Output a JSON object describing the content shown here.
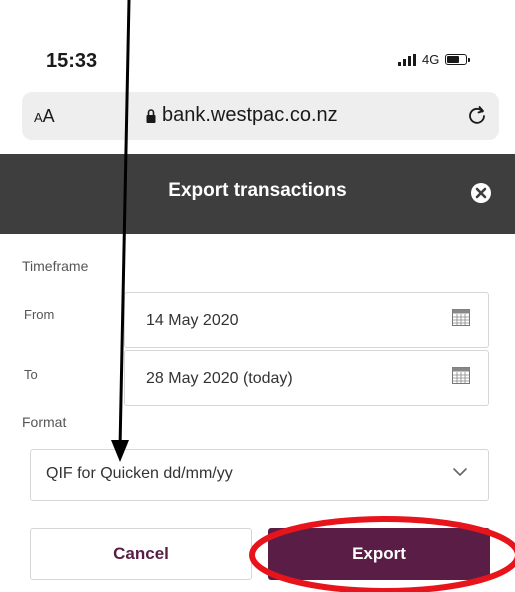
{
  "status_bar": {
    "time": "15:33",
    "network": "4G",
    "battery_level": 0.7
  },
  "browser": {
    "text_size_label_small": "A",
    "text_size_label_large": "A",
    "url": "bank.westpac.co.nz"
  },
  "dialog": {
    "title": "Export transactions",
    "timeframe_label": "Timeframe",
    "from_label": "From",
    "from_value": "14 May 2020",
    "to_label": "To",
    "to_value": "28 May 2020 (today)",
    "format_label": "Format",
    "format_value": "QIF for Quicken dd/mm/yy",
    "cancel_label": "Cancel",
    "export_label": "Export"
  },
  "colors": {
    "header_bg": "#3e3e3e",
    "accent": "#5a1e46",
    "annotation_red": "#e8141b",
    "annotation_arrow": "#000000"
  },
  "icons": {
    "lock": "lock-icon",
    "reload": "reload-icon",
    "close": "close-circle-icon",
    "calendar": "calendar-icon",
    "dropdown": "chevron-down-icon"
  }
}
